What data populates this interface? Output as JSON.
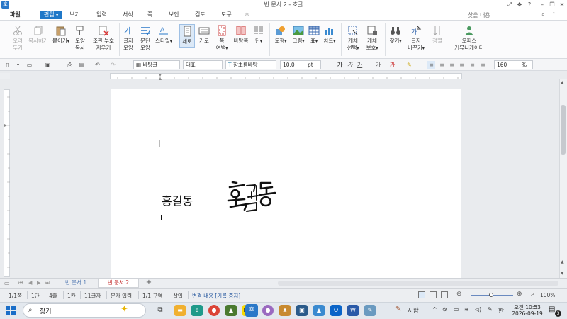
{
  "window": {
    "title": "빈 문서 2 - 호글",
    "app_icon": "hwp-icon"
  },
  "menu": {
    "file": "파일",
    "edit": "편집",
    "items": [
      "보기",
      "입력",
      "서식",
      "쪽",
      "보안",
      "검토",
      "도구"
    ],
    "help_placeholder": "찾을 내용"
  },
  "ribbon": {
    "cut": [
      "오려",
      "두기"
    ],
    "copy": "복사하기",
    "paste": "붙이기",
    "format_copy": [
      "모양",
      "복사"
    ],
    "clear_format": [
      "조판 부호",
      "지우기"
    ],
    "char_shape": [
      "글자",
      "모양"
    ],
    "para_shape": [
      "문단",
      "모양"
    ],
    "style": "스타일",
    "vertical": "세로",
    "horizontal": "가로",
    "page_margin": [
      "쪽",
      "여백"
    ],
    "background": "바탕쪽",
    "column": "단",
    "shape": "도형",
    "picture": "그림",
    "table": "표",
    "chart": "차트",
    "obj_select": [
      "개체",
      "선택"
    ],
    "obj_protect": [
      "개체",
      "보호"
    ],
    "find": "찾기",
    "replace": [
      "글자",
      "바꾸기"
    ],
    "align": "정렬",
    "office_community": [
      "오피스",
      "커뮤니케이터"
    ]
  },
  "toolbar2": {
    "style": "바탕글",
    "category": "대표",
    "font": "함초롬바탕",
    "size": "10.0",
    "unit": "pt",
    "zoom": "160",
    "zoom_unit": "%"
  },
  "document": {
    "text": "홍길동",
    "signature": "홍길동"
  },
  "tabs": [
    "빈 문서 1",
    "빈 문서 2"
  ],
  "status": {
    "page": "1/1쪽",
    "section": "1단",
    "line": "4줄",
    "col": "1칸",
    "chars": "11글자",
    "mode": "문자 입력",
    "area": "1/1 구역",
    "insert": "삽입",
    "track": "변경 내용 [기록 중지]",
    "zoom": "100%"
  },
  "taskbar": {
    "search": "찾기",
    "weather": "시합",
    "ime": "한",
    "time": "오전 10:53",
    "date": "2026-09-19",
    "notifications": "3"
  },
  "colors": {
    "accent": "#1f78c8",
    "active_tab_text": "#c43030"
  }
}
